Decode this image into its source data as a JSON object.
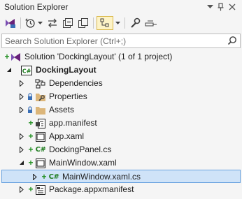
{
  "window": {
    "title": "Solution Explorer",
    "title_buttons": [
      "chevron-down-icon",
      "pin-icon",
      "close-icon"
    ]
  },
  "toolbar": {
    "tools": [
      "vs-switch-views-icon",
      "history-icon",
      "chevron-down-icon",
      "sync-icon",
      "collapse-all-icon",
      "show-all-files-icon",
      "view-mode-icon",
      "chevron-down-icon",
      "properties-wrench-icon",
      "preview-icon"
    ]
  },
  "search": {
    "placeholder": "Search Solution Explorer (Ctrl+;)"
  },
  "tree": {
    "items": [
      {
        "label": "Solution 'DockingLayout' (1 of 1 project)",
        "status": "+",
        "icon": "solution-icon"
      },
      {
        "label": "DockingLayout",
        "icon": "csharp-project-icon",
        "expanded": true
      },
      {
        "label": "Dependencies",
        "icon": "dependencies-icon",
        "expandable": true
      },
      {
        "label": "Properties",
        "icon": "folder-wrench-icon",
        "lock": true,
        "expandable": true
      },
      {
        "label": "Assets",
        "icon": "folder-icon",
        "lock": true,
        "expandable": true
      },
      {
        "label": "app.manifest",
        "status": "+",
        "icon": "manifest-icon"
      },
      {
        "label": "App.xaml",
        "status": "+",
        "icon": "xaml-icon",
        "expandable": true
      },
      {
        "label": "DockingPanel.cs",
        "status": "+",
        "icon": "csharp-file-icon",
        "expandable": true
      },
      {
        "label": "MainWindow.xaml",
        "status": "+",
        "icon": "xaml-icon",
        "expanded": true
      },
      {
        "label": "MainWindow.xaml.cs",
        "status": "+",
        "icon": "csharp-file-icon",
        "expandable": true,
        "selected": true
      },
      {
        "label": "Package.appxmanifest",
        "status": "+",
        "icon": "package-manifest-icon",
        "expandable": true
      }
    ]
  },
  "colors": {
    "selection_bg": "#cfe3f8",
    "selection_border": "#6aa3e0",
    "added_green": "#1e8e1e",
    "csharp_green": "#1e7b1e",
    "folder_yellow": "#dcb67a"
  },
  "icons": {
    "csharp_glyph": "C#",
    "status_added": "+",
    "lock_glyph": "🔒"
  }
}
